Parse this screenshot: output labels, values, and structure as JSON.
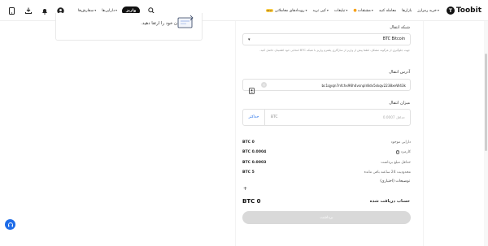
{
  "header": {
    "brand": "Toobit",
    "nav": [
      {
        "label": "خرید رمزارز",
        "dropdown": true
      },
      {
        "label": "بازارها",
        "dropdown": false
      },
      {
        "label": "معامله کنید",
        "dropdown": false
      },
      {
        "label": "مشتقات",
        "dropdown": true
      },
      {
        "label": "تبلیغات",
        "dropdown": true
      },
      {
        "label": "کپی ترید",
        "dropdown": true
      },
      {
        "label": "رویدادهای معاملاتی",
        "dropdown": true
      }
    ],
    "hot_badge": "NEW",
    "deposit_label": "واریز",
    "assets_label": "دارایی‌ها",
    "orders_label": "سفارش‌ها"
  },
  "left_card": {
    "text": "ن خود را ارتقا دهید."
  },
  "withdraw": {
    "network_label": "شبکه انتقال",
    "network_value": "BTC Bitcoin",
    "network_note": "جهت جلوگیری از هرگونه مشکل، لطفا پیش از واریز از سازگاری پلتفرم واریز با شبکه BTC انتخابی خود اطمینان حاصل کنید.",
    "address_label": "آدرس انتقال",
    "address_value": "bc1qyqn7nfchx96h4vsnplr8dv5skqv2238xeW43k",
    "amount_label": "میزان انتقال",
    "amount_placeholder": "حداقل 0.0007",
    "amount_unit": "BTC",
    "max_label": "حداکثر",
    "details": [
      {
        "key": "دارایی موجود",
        "value": "BTC 0"
      },
      {
        "key": "کارمزد",
        "value": "BTC 0.0004"
      },
      {
        "key": "حداقل مبلغ برداشت",
        "value": "BTC 0.0003"
      },
      {
        "key": "محدودیت 24 ساعته باقی مانده",
        "value": "BTC 5"
      }
    ],
    "notes_label": "توضیحات (اختیاری)",
    "receive_label": "حساب دریافت شده",
    "receive_value": "BTC 0",
    "submit_label": "برداشت"
  },
  "colors": {
    "accent": "#1e6ce8",
    "max_text": "#1e6ce8",
    "disabled_button": "#d9d9d9"
  }
}
